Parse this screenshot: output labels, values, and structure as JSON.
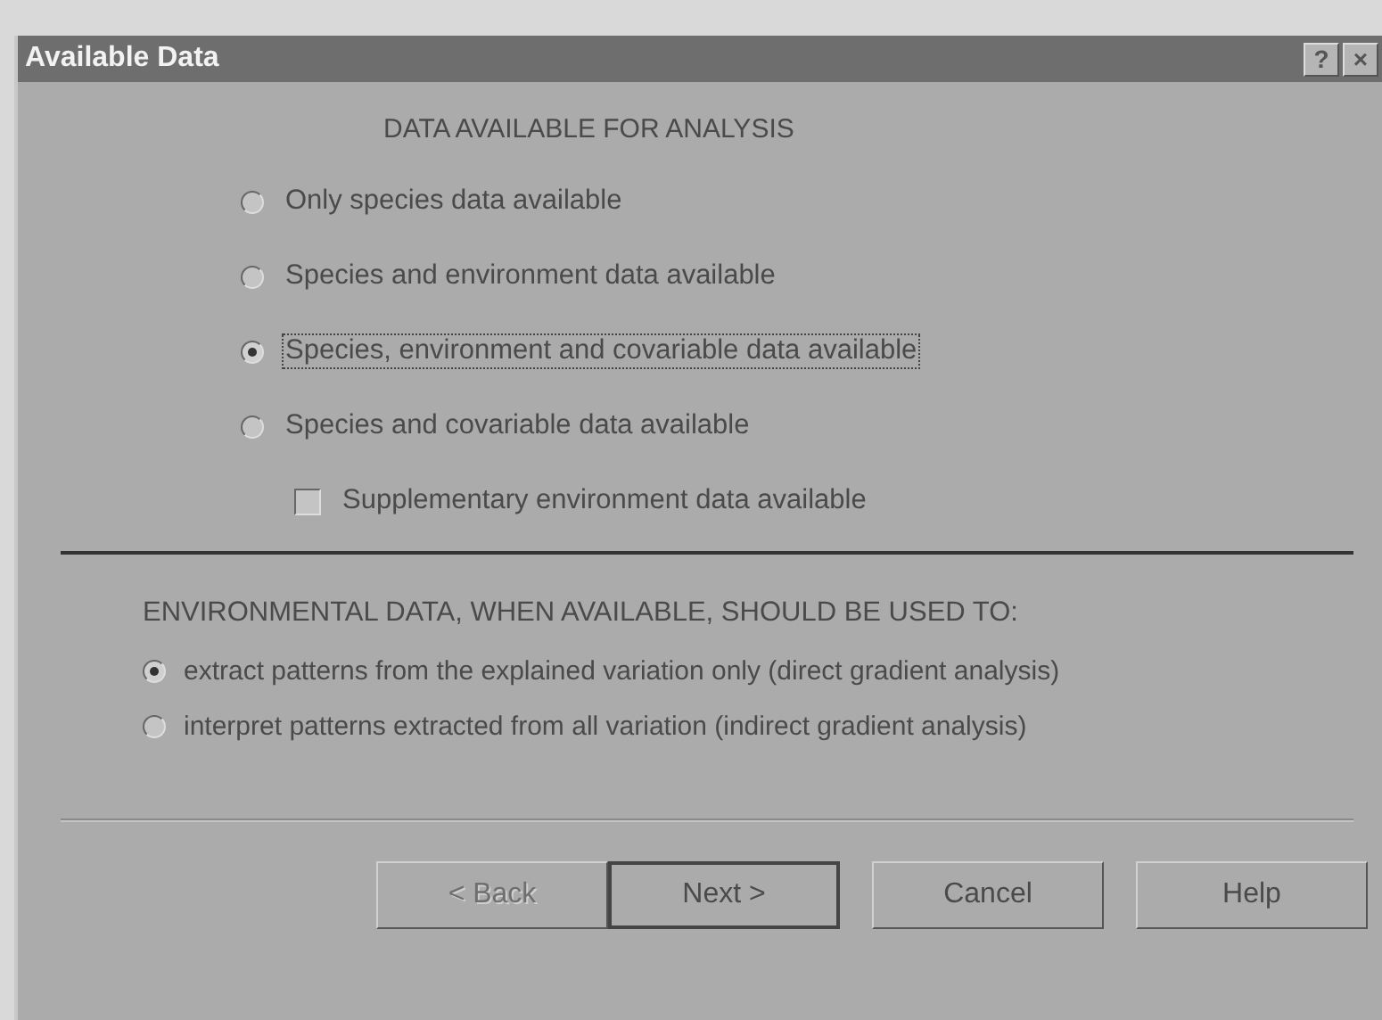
{
  "window": {
    "title": "Available Data",
    "title_buttons": [
      "?",
      "×"
    ]
  },
  "data_section": {
    "heading": "DATA AVAILABLE FOR ANALYSIS",
    "options": [
      {
        "label": "Only species data available",
        "selected": false,
        "focused": false
      },
      {
        "label": "Species and environment data available",
        "selected": false,
        "focused": false
      },
      {
        "label": "Species, environment and covariable data available",
        "selected": true,
        "focused": true
      },
      {
        "label": "Species and covariable data available",
        "selected": false,
        "focused": false
      }
    ],
    "supplementary": {
      "label": "Supplementary environment data available",
      "checked": false
    }
  },
  "environment_section": {
    "heading": "ENVIRONMENTAL DATA, WHEN AVAILABLE, SHOULD BE USED TO:",
    "options": [
      {
        "label": "extract patterns from the explained variation only (direct gradient analysis)",
        "selected": true
      },
      {
        "label": "interpret patterns extracted from all variation (indirect gradient analysis)",
        "selected": false
      }
    ]
  },
  "buttons": [
    {
      "label": "< Back",
      "disabled": true,
      "default": false
    },
    {
      "label": "Next >",
      "disabled": false,
      "default": true
    },
    {
      "label": "Cancel",
      "disabled": false,
      "default": false
    },
    {
      "label": "Help",
      "disabled": false,
      "default": false
    }
  ]
}
